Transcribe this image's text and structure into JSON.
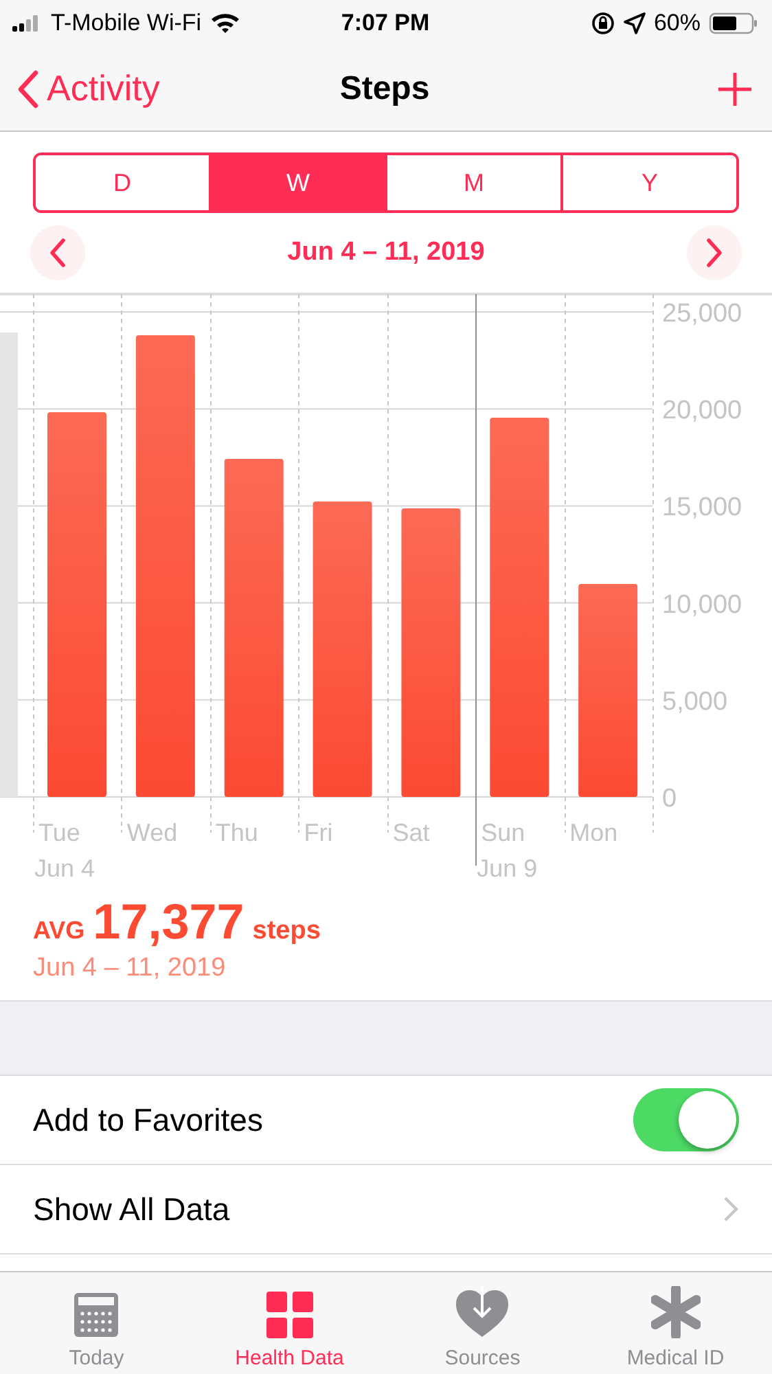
{
  "status_bar": {
    "carrier": "T-Mobile Wi-Fi",
    "time": "7:07 PM",
    "battery": "60%"
  },
  "nav": {
    "back": "Activity",
    "title": "Steps"
  },
  "segments": [
    {
      "label": "D",
      "selected": false
    },
    {
      "label": "W",
      "selected": true
    },
    {
      "label": "M",
      "selected": false
    },
    {
      "label": "Y",
      "selected": false
    }
  ],
  "date_range": "Jun 4 – 11, 2019",
  "chart": {
    "chart_data": {
      "type": "bar",
      "categories": [
        "Tue",
        "Wed",
        "Thu",
        "Fri",
        "Sat",
        "Sun",
        "Mon"
      ],
      "values": [
        19830,
        23800,
        17420,
        15230,
        14870,
        19550,
        10980
      ],
      "grid": true,
      "ylim": [
        0,
        25000
      ],
      "yticks": [
        0,
        {
          "value": 5000,
          "label": "5,000"
        },
        {
          "value": 10000,
          "label": "10,000"
        },
        {
          "value": 15000,
          "label": "15,000"
        },
        {
          "value": 20000,
          "label": "20,000"
        },
        {
          "value": 25000,
          "label": "25,000"
        }
      ]
    },
    "date_labels": [
      "Jun 4",
      "Jun 9"
    ]
  },
  "summary": {
    "prefix": "AVG",
    "value": "17,377",
    "unit": "steps",
    "range": "Jun 4 – 11, 2019"
  },
  "rows": [
    {
      "kind": "toggle",
      "label": "Add to Favorites",
      "on": true
    },
    {
      "kind": "link",
      "label": "Show All Data"
    }
  ],
  "tabs": [
    {
      "label": "Today",
      "selected": false
    },
    {
      "label": "Health Data",
      "selected": true
    },
    {
      "label": "Sources",
      "selected": false
    },
    {
      "label": "Medical ID",
      "selected": false
    }
  ]
}
